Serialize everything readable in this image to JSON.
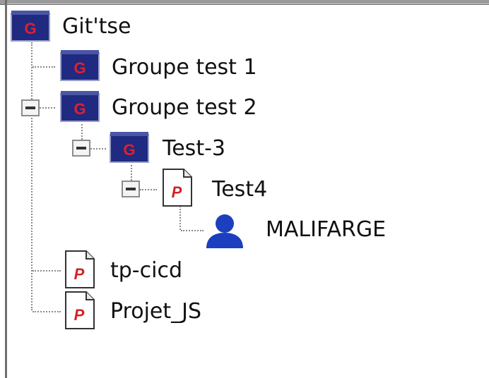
{
  "window": {
    "title": ""
  },
  "tree": {
    "root": {
      "label": "Git'tse",
      "icon": "group-icon",
      "expanded": true
    },
    "items": [
      {
        "label": "Groupe test 1",
        "icon": "group-icon",
        "depth": 1,
        "expanded": false,
        "has_toggle": false
      },
      {
        "label": "Groupe test 2",
        "icon": "group-icon",
        "depth": 1,
        "expanded": true,
        "has_toggle": true,
        "toggle_symbol": "−"
      },
      {
        "label": "Test-3",
        "icon": "group-icon",
        "depth": 2,
        "expanded": true,
        "has_toggle": true,
        "toggle_symbol": "−"
      },
      {
        "label": "Test4",
        "icon": "project-icon",
        "depth": 3,
        "expanded": true,
        "has_toggle": true,
        "toggle_symbol": "−"
      },
      {
        "label": "MALIFARGE",
        "icon": "user-icon",
        "depth": 4,
        "expanded": false,
        "has_toggle": false
      },
      {
        "label": "tp-cicd",
        "icon": "project-icon",
        "depth": 1,
        "expanded": false,
        "has_toggle": false
      },
      {
        "label": "Projet_JS",
        "icon": "project-icon",
        "depth": 1,
        "expanded": false,
        "has_toggle": false
      }
    ]
  },
  "icon_glyphs": {
    "group": "G",
    "project": "P"
  },
  "colors": {
    "group_icon": "#1f2a80",
    "group_letter": "#e0202c",
    "project_letter": "#d61f26",
    "user_icon": "#1c3fbf",
    "connector": "#8a8a8a"
  }
}
